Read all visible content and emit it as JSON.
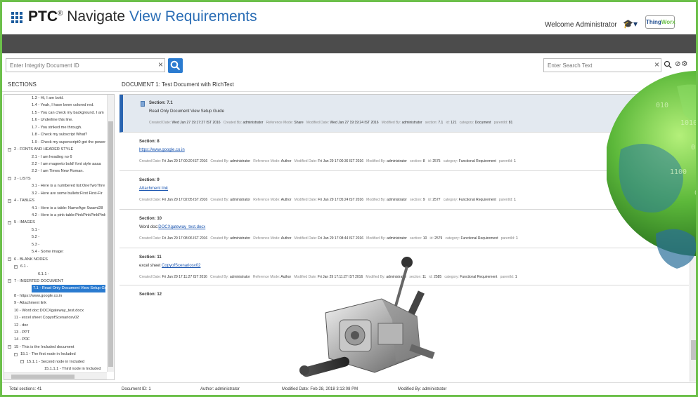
{
  "header": {
    "brand": "PTC",
    "reg": "®",
    "title_plain": " Navigate ",
    "title_highlight": "View Requirements",
    "welcome": "Welcome  Administrator",
    "thingworx_a": "Thing",
    "thingworx_b": "Worx"
  },
  "search": {
    "docid_placeholder": "Enter Integrity Document ID",
    "text_placeholder": "Enter Search Text",
    "clear_glyph": "×",
    "settings_glyph": "⊘⚙"
  },
  "sections_label": "SECTIONS",
  "doc_title": "DOCUMENT 1: Test Document with RichText",
  "tree": [
    {
      "text": "1.3 - Hi, I am bold.",
      "indent": 2
    },
    {
      "text": "1.4 - Yeah, I have been colored red.",
      "indent": 2
    },
    {
      "text": "1.5 - You can check my background. I am",
      "indent": 2
    },
    {
      "text": "1.6 - Underline this line.",
      "indent": 2
    },
    {
      "text": "1.7 - You striked me through.",
      "indent": 2
    },
    {
      "text": "1.8 - Check my subscript What?",
      "indent": 2
    },
    {
      "text": "1.9 - Check my superscript0 got the power",
      "indent": 2
    },
    {
      "text": "2 - FONTS AND HEADER STYLE",
      "indent": 1,
      "toggle": "−"
    },
    {
      "text": "2.1 - I am heading no 6",
      "indent": 2
    },
    {
      "text": "2.2 - I am magneto bold! font style aaaa",
      "indent": 2
    },
    {
      "text": "2.3 - I am Times New Roman.",
      "indent": 2
    },
    {
      "text": "3 - LISTS",
      "indent": 1,
      "toggle": "−"
    },
    {
      "text": "3.1 - Here is a numbered list:OneTwoThre",
      "indent": 2
    },
    {
      "text": "3.2 - Here are some bullets:First  First-Fir",
      "indent": 2
    },
    {
      "text": "4 - TABLES",
      "indent": 1,
      "toggle": "−"
    },
    {
      "text": "4.1 - Here is a table: NameAge  Swami28",
      "indent": 2
    },
    {
      "text": "4.2 - Here is a pink table:PinkPinkPinkPink",
      "indent": 2
    },
    {
      "text": "5 - IMAGES",
      "indent": 1,
      "toggle": "−"
    },
    {
      "text": "5.1 -",
      "indent": 2
    },
    {
      "text": "5.2 -",
      "indent": 2
    },
    {
      "text": "5.3 -",
      "indent": 2
    },
    {
      "text": "5.4 - Some image:",
      "indent": 2
    },
    {
      "text": "6 - BLANK NODES",
      "indent": 1,
      "toggle": "−"
    },
    {
      "text": "6.1 -",
      "indent": 2,
      "toggle": "−"
    },
    {
      "text": "6.1.1 -",
      "indent": 3
    },
    {
      "text": "7 - INSERTED DOCUMENT",
      "indent": 1,
      "toggle": "−"
    },
    {
      "text": "7.1 - Read Only Document View Setup Gu",
      "indent": 2,
      "selected": true
    },
    {
      "text": "8 - https://www.google.co.in",
      "indent": 1
    },
    {
      "text": "9 - Attachment link",
      "indent": 1
    },
    {
      "text": "10 - Word doc:DOCXgateway_test.docx",
      "indent": 1
    },
    {
      "text": "11 - excel sheet CopyofScenariosv02",
      "indent": 1
    },
    {
      "text": "12 - doc",
      "indent": 1
    },
    {
      "text": "13 - PPT",
      "indent": 1
    },
    {
      "text": "14 - PDF",
      "indent": 1
    },
    {
      "text": "15 - This is the Included document",
      "indent": 1,
      "toggle": "−"
    },
    {
      "text": "15.1 - The first node in Included",
      "indent": 2,
      "toggle": "−"
    },
    {
      "text": "15.1.1 - Second node in Included",
      "indent": 3,
      "toggle": "−"
    },
    {
      "text": "15.1.1.1 - Third node in Included",
      "indent": 4
    }
  ],
  "sections": [
    {
      "title": "Section: 7.1",
      "body": "Read Only Document View Setup Guide",
      "link": "",
      "meta": [
        [
          "Created Date:",
          "Wed Jan 27 19:17:27 IST 2016"
        ],
        [
          "Created By:",
          "administrator"
        ],
        [
          "Reference Mode:",
          "Share"
        ],
        [
          "Modified Date:",
          "Wed Jan 27 19:19:24 IST 2016"
        ],
        [
          "Modified By:",
          "administrator"
        ],
        [
          "section:",
          "7.1"
        ],
        [
          "id:",
          "121"
        ],
        [
          "category:",
          "Document"
        ],
        [
          "parentId:",
          "81"
        ]
      ]
    },
    {
      "title": "Section: 8",
      "body": "",
      "link": "https://www.google.co.in",
      "meta": [
        [
          "Created Date:",
          "Fri Jan 29 17:00:20 IST 2016"
        ],
        [
          "Created By:",
          "administrator"
        ],
        [
          "Reference Mode:",
          "Author"
        ],
        [
          "Modified Date:",
          "Fri Jan 29 17:00:36 IST 2016"
        ],
        [
          "Modified By:",
          "administrator"
        ],
        [
          "section:",
          "8"
        ],
        [
          "id:",
          "2575"
        ],
        [
          "category:",
          "Functional Requirement"
        ],
        [
          "parentId:",
          "1"
        ]
      ]
    },
    {
      "title": "Section: 9",
      "body": "",
      "link": "Attachment link",
      "meta": [
        [
          "Created Date:",
          "Fri Jan 29 17:02:05 IST 2016"
        ],
        [
          "Created By:",
          "administrator"
        ],
        [
          "Reference Mode:",
          "Author"
        ],
        [
          "Modified Date:",
          "Fri Jan 29 17:05:24 IST 2016"
        ],
        [
          "Modified By:",
          "administrator"
        ],
        [
          "section:",
          "9"
        ],
        [
          "id:",
          "2577"
        ],
        [
          "category:",
          "Functional Requirement"
        ],
        [
          "parentId:",
          "1"
        ]
      ]
    },
    {
      "title": "Section: 10",
      "body": "Word doc:",
      "link": "DOCXgateway_test.docx",
      "meta": [
        [
          "Created Date:",
          "Fri Jan 29 17:08:06 IST 2016"
        ],
        [
          "Created By:",
          "administrator"
        ],
        [
          "Reference Mode:",
          "Author"
        ],
        [
          "Modified Date:",
          "Fri Jan 29 17:08:44 IST 2016"
        ],
        [
          "Modified By:",
          "administrator"
        ],
        [
          "section:",
          "10"
        ],
        [
          "id:",
          "2579"
        ],
        [
          "category:",
          "Functional Requirement"
        ],
        [
          "parentId:",
          "1"
        ]
      ]
    },
    {
      "title": "Section: 11",
      "body": "excel sheet ",
      "link": "CopyofScenariosv02",
      "meta": [
        [
          "Created Date:",
          "Fri Jan 29 17:11:27 IST 2016"
        ],
        [
          "Created By:",
          "administrator"
        ],
        [
          "Reference Mode:",
          "Author"
        ],
        [
          "Modified Date:",
          "Fri Jan 29 17:11:27 IST 2016"
        ],
        [
          "Modified By:",
          "administrator"
        ],
        [
          "section:",
          "11"
        ],
        [
          "id:",
          "2585"
        ],
        [
          "category:",
          "Functional Requirement"
        ],
        [
          "parentId:",
          "1"
        ]
      ]
    },
    {
      "title": "Section: 12",
      "body": "",
      "link": "",
      "meta": []
    }
  ],
  "footer": {
    "total": "Total sections: 41",
    "docid": "Document ID: 1",
    "author": "Author: administrator",
    "modified_date": "Modified Date: Feb 28, 2018 3:13:08 PM",
    "modified_by": "Modified By: administrator"
  },
  "colors": {
    "accent": "#2a7bd0",
    "frame": "#6cc04a",
    "bar": "#4c4c4c"
  }
}
